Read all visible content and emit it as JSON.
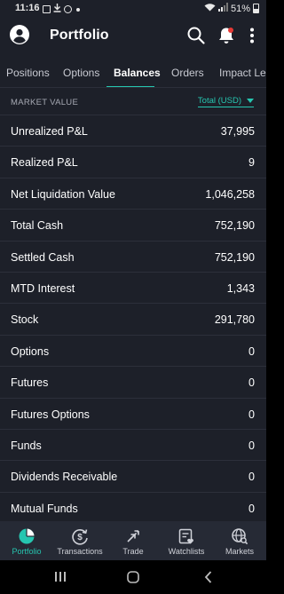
{
  "status_bar": {
    "time": "11:16",
    "battery": "51%",
    "icons": [
      "gallery-icon",
      "download-icon",
      "circle-icon",
      "dot-icon",
      "wifi-icon",
      "signal-icon",
      "battery-icon"
    ]
  },
  "header": {
    "title": "Portfolio",
    "icons": [
      "account-icon",
      "search-icon",
      "bell-icon",
      "more-vertical-icon"
    ]
  },
  "tabs": [
    {
      "label": "Positions",
      "active": false
    },
    {
      "label": "Options",
      "active": false
    },
    {
      "label": "Balances",
      "active": true
    },
    {
      "label": "Orders",
      "active": false
    },
    {
      "label": "Impact Len",
      "active": false
    }
  ],
  "market_value": {
    "label": "MARKET VALUE",
    "currency_select": "Total (USD)"
  },
  "balances": [
    {
      "label": "Unrealized P&L",
      "value": "37,995"
    },
    {
      "label": "Realized P&L",
      "value": "9"
    },
    {
      "label": "Net Liquidation Value",
      "value": "1,046,258"
    },
    {
      "label": "Total Cash",
      "value": "752,190"
    },
    {
      "label": "Settled Cash",
      "value": "752,190"
    },
    {
      "label": "MTD Interest",
      "value": "1,343"
    },
    {
      "label": "Stock",
      "value": "291,780"
    },
    {
      "label": "Options",
      "value": "0"
    },
    {
      "label": "Futures",
      "value": "0"
    },
    {
      "label": "Futures Options",
      "value": "0"
    },
    {
      "label": "Funds",
      "value": "0"
    },
    {
      "label": "Dividends Receivable",
      "value": "0"
    },
    {
      "label": "Mutual Funds",
      "value": "0"
    }
  ],
  "bottom_nav": [
    {
      "label": "Portfolio",
      "icon": "pie-chart-icon",
      "active": true
    },
    {
      "label": "Transactions",
      "icon": "dollar-cycle-icon",
      "active": false
    },
    {
      "label": "Trade",
      "icon": "trade-arrows-icon",
      "active": false
    },
    {
      "label": "Watchlists",
      "icon": "watchlist-heart-icon",
      "active": false
    },
    {
      "label": "Markets",
      "icon": "globe-search-icon",
      "active": false
    }
  ],
  "colors": {
    "background": "#1d2029",
    "accent": "#26c6b0",
    "divider": "#2c2f3a",
    "notification": "#e53935"
  }
}
